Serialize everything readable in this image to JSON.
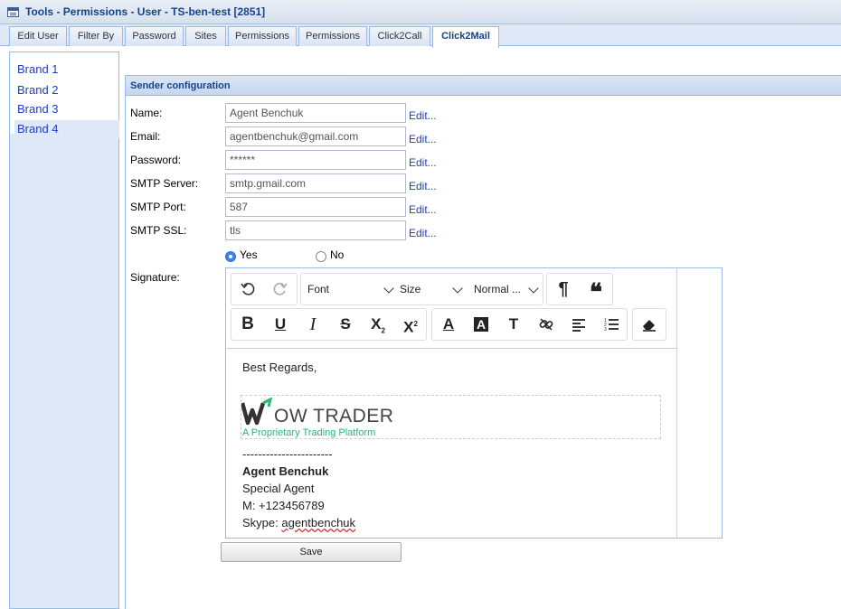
{
  "window": {
    "title": "Tools - Permissions - User - TS-ben-test [2851]"
  },
  "tabs": [
    {
      "label": "Edit User"
    },
    {
      "label": "Filter By"
    },
    {
      "label": "Password"
    },
    {
      "label": "Sites"
    },
    {
      "label": "Permissions"
    },
    {
      "label": "Permissions"
    },
    {
      "label": "Click2Call"
    },
    {
      "label": "Click2Mail",
      "active": true
    }
  ],
  "brands": [
    {
      "label": "Brand 1"
    },
    {
      "label": "Brand 2"
    },
    {
      "label": "Brand 3"
    },
    {
      "label": "Brand 4",
      "selected": true
    }
  ],
  "sender": {
    "header": "Sender configuration",
    "fields": [
      {
        "label": "Name:",
        "value": "Agent Benchuk",
        "edit": "Edit..."
      },
      {
        "label": "Email:",
        "value": "agentbenchuk@gmail.com",
        "edit": "Edit..."
      },
      {
        "label": "Password:",
        "value": "******",
        "edit": "Edit..."
      },
      {
        "label": "SMTP Server:",
        "value": "smtp.gmail.com",
        "edit": "Edit..."
      },
      {
        "label": "SMTP Port:",
        "value": "587",
        "edit": "Edit..."
      },
      {
        "label": "SMTP SSL:",
        "value": "tls",
        "edit": "Edit..."
      }
    ],
    "radio": {
      "yes": "Yes",
      "no": "No",
      "selected": "Yes"
    },
    "signature_label": "Signature:"
  },
  "editor": {
    "toolbar": {
      "font": "Font",
      "size": "Size",
      "style": "Normal ...",
      "icons": [
        "undo-icon",
        "redo-icon",
        "paragraph-icon",
        "blockquote-icon",
        "bold-icon",
        "underline-icon",
        "italic-icon",
        "strikethrough-icon",
        "subscript-icon",
        "superscript-icon",
        "text-color-icon",
        "background-color-icon",
        "clear-format-icon",
        "link-icon",
        "align-icon",
        "ordered-list-icon",
        "eraser-icon"
      ]
    },
    "content": {
      "greeting": "Best Regards,",
      "logo_main": "OW TRADER",
      "logo_tagline": "A Proprietary Trading Platform",
      "divider": "-----------------------",
      "name": "Agent Benchuk",
      "title": "Special Agent",
      "phone": "M: +123456789",
      "skype_prefix": "Skype: ",
      "skype": "agentbenchuk"
    }
  },
  "save_label": "Save"
}
